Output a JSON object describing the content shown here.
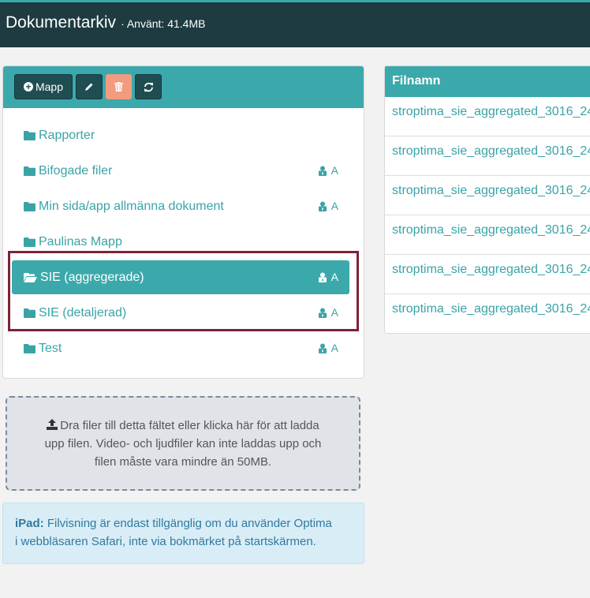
{
  "header": {
    "title": "Dokumentarkiv",
    "used": "· Använt: 41.4MB"
  },
  "toolbar": {
    "add_folder_label": "Mapp"
  },
  "folders": [
    {
      "name": "Rapporter",
      "lock": ""
    },
    {
      "name": "Bifogade filer",
      "lock": "A"
    },
    {
      "name": "Min sida/app allmänna dokument",
      "lock": "A"
    },
    {
      "name": "Paulinas Mapp",
      "lock": ""
    },
    {
      "name": "SIE (aggregerade)",
      "lock": "A",
      "selected": true
    },
    {
      "name": "SIE (detaljerad)",
      "lock": "A"
    },
    {
      "name": "Test",
      "lock": "A"
    }
  ],
  "files": {
    "header": "Filnamn",
    "rows": [
      "stroptima_sie_aggregated_3016_24",
      "stroptima_sie_aggregated_3016_24",
      "stroptima_sie_aggregated_3016_24",
      "stroptima_sie_aggregated_3016_24",
      "stroptima_sie_aggregated_3016_24",
      "stroptima_sie_aggregated_3016_24"
    ]
  },
  "dropzone": {
    "line1": "Dra filer till detta fältet eller klicka här för att ladda",
    "line2": "upp filen. Video- och ljudfiler kan inte laddas upp och",
    "line3": "filen måste vara mindre än 50MB."
  },
  "info": {
    "label": "iPad:",
    "text1": "Filvisning är endast tillgänglig om du använder Optima",
    "text2": "i webbläsaren Safari, inte via bokmärket på startskärmen."
  },
  "colors": {
    "accent": "#3ba9ab",
    "header_bg": "#1d3b40",
    "delete": "#f39b7f",
    "highlight": "#7d2236"
  }
}
